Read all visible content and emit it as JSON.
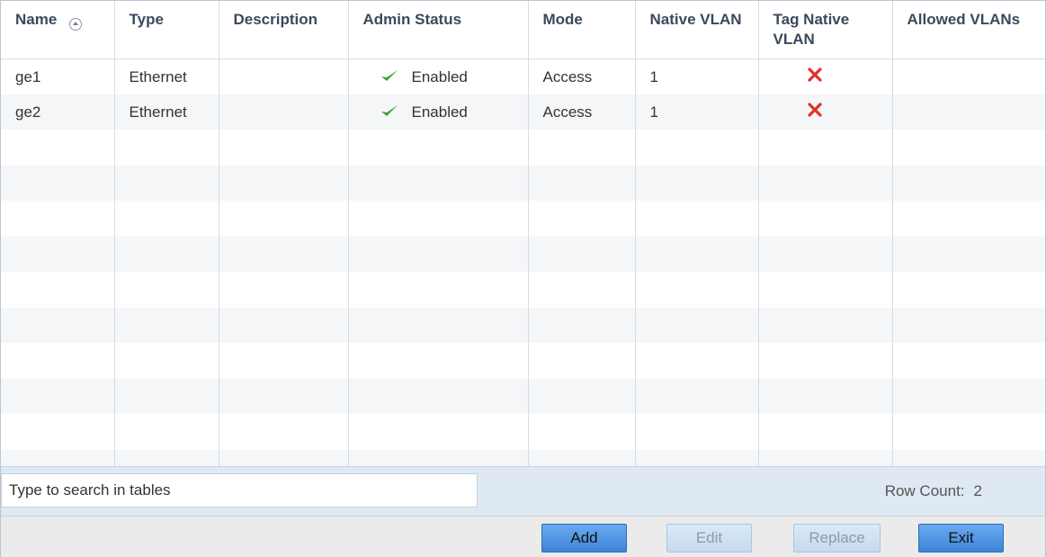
{
  "table": {
    "columns": [
      "Name",
      "Type",
      "Description",
      "Admin Status",
      "Mode",
      "Native VLAN",
      "Tag Native VLAN",
      "Allowed VLANs"
    ],
    "sort_column": "Name",
    "rows": [
      {
        "name": "ge1",
        "type": "Ethernet",
        "description": "",
        "admin_status": "Enabled",
        "mode": "Access",
        "native_vlan": "1",
        "tag_native_vlan": false,
        "allowed_vlans": ""
      },
      {
        "name": "ge2",
        "type": "Ethernet",
        "description": "",
        "admin_status": "Enabled",
        "mode": "Access",
        "native_vlan": "1",
        "tag_native_vlan": false,
        "allowed_vlans": ""
      }
    ]
  },
  "search": {
    "placeholder": "Type to search in tables"
  },
  "row_count": {
    "label": "Row Count:",
    "value": "2"
  },
  "buttons": {
    "add": {
      "label": "Add",
      "enabled": true
    },
    "edit": {
      "label": "Edit",
      "enabled": false
    },
    "replace": {
      "label": "Replace",
      "enabled": false
    },
    "exit": {
      "label": "Exit",
      "enabled": true
    }
  },
  "icons": {
    "enabled": "check-icon",
    "tag_native_vlan_off": "x-icon",
    "sort": "sort-ascending-icon"
  },
  "colors": {
    "check": "#3aa53a",
    "x": "#e0302a",
    "button_primary": "#4a8fdd",
    "footer_band": "#dfe9f3"
  }
}
